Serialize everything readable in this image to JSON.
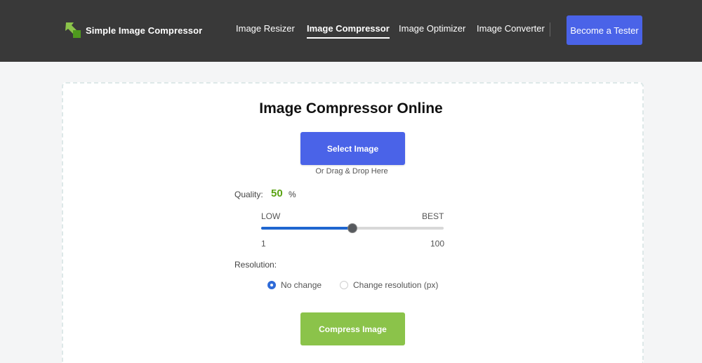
{
  "header": {
    "brand": "Simple Image Compressor",
    "nav": [
      {
        "label": "Image Resizer",
        "active": false
      },
      {
        "label": "Image Compressor",
        "active": true
      },
      {
        "label": "Image Optimizer",
        "active": false
      },
      {
        "label": "Image Converter",
        "active": false
      }
    ],
    "cta_label": "Become a Tester"
  },
  "main": {
    "title": "Image Compressor Online",
    "select_label": "Select Image",
    "drag_hint": "Or Drag & Drop Here",
    "quality": {
      "label": "Quality:",
      "value": "50",
      "unit": "%",
      "low_label": "LOW",
      "best_label": "BEST",
      "min": "1",
      "max": "100",
      "level": 0.5
    },
    "resolution": {
      "label": "Resolution:",
      "options": [
        {
          "label": "No change",
          "checked": true
        },
        {
          "label": "Change resolution (px)",
          "checked": false
        }
      ]
    },
    "compress_label": "Compress Image"
  },
  "colors": {
    "header_bg": "#393939",
    "accent_blue": "#4a63e8",
    "compress_green": "#8bc34a",
    "quality_green": "#5aa312",
    "slider_fill": "#1f66d0"
  }
}
